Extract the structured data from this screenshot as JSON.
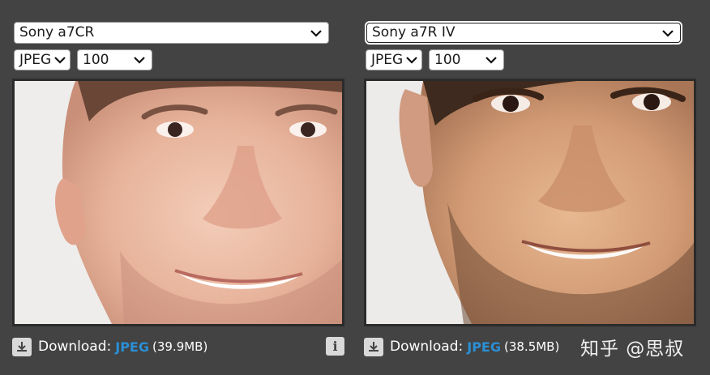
{
  "left": {
    "camera": "Sony a7CR",
    "format": "JPEG",
    "quality": "100",
    "download_label": "Download:",
    "download_format": "JPEG",
    "download_size": "(39.9MB)"
  },
  "right": {
    "camera": "Sony a7R IV",
    "format": "JPEG",
    "quality": "100",
    "download_label": "Download:",
    "download_format": "JPEG",
    "download_size": "(38.5MB)"
  },
  "watermark": "知乎 @思叔",
  "icons": {
    "download": "download-icon",
    "info": "info-icon",
    "dropdown": "chevron-down-icon"
  },
  "colors": {
    "background": "#434343",
    "link": "#2a8fd6"
  }
}
